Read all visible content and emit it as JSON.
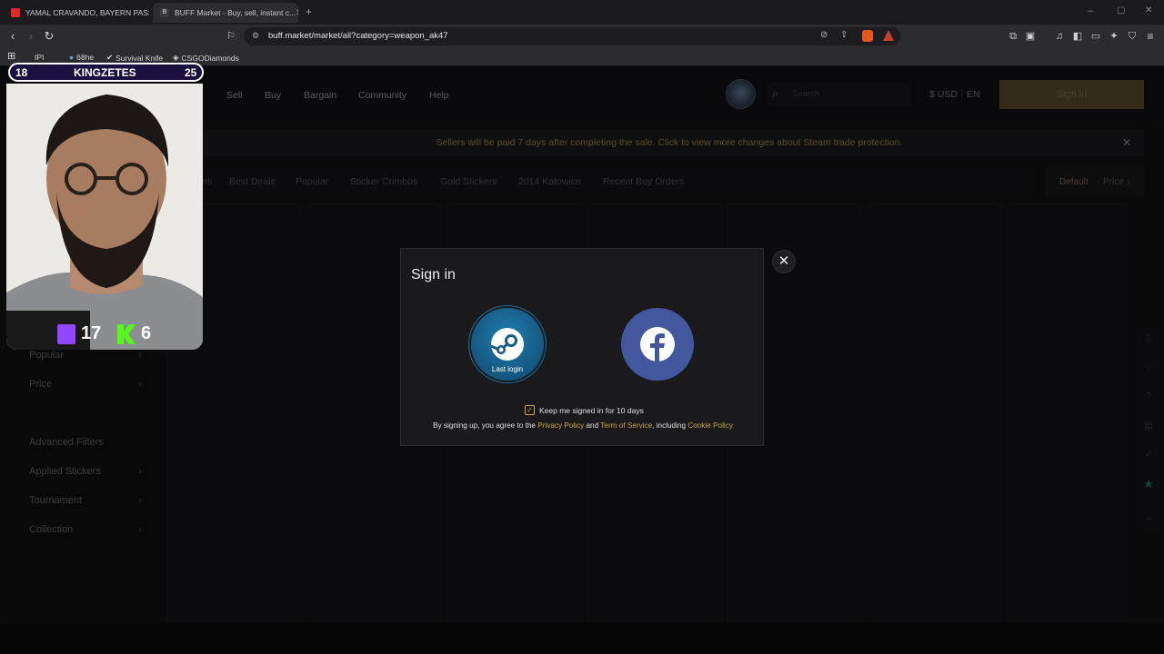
{
  "browser": {
    "tabs": [
      {
        "title": "YAMAL CRAVANDO, BAYERN PASSE...",
        "active": false
      },
      {
        "title": "BUFF Market - Buy, sell, instant c...",
        "active": true
      }
    ],
    "new_tab": "+",
    "url": "buff.market/market/all?category=weapon_ak47",
    "bookmarks": [
      "IPI",
      "68he",
      "Survival Knife",
      "CSGODiamonds"
    ]
  },
  "site": {
    "nav": [
      "Sell",
      "Buy",
      "Bargain",
      "Community",
      "Help"
    ],
    "search_placeholder": "Search",
    "currency": "$ USD",
    "language": "EN",
    "signin_label": "Sign in",
    "notice": "Sellers will be paid 7 days after completing the sale. Click to view more changes about Steam trade protection.",
    "filter_tabs": [
      "ns",
      "Best Deals",
      "Popular",
      "Sticker Combos",
      "Gold Stickers",
      "2014 Katowice",
      "Recent Buy Orders"
    ],
    "sort_default": "Default",
    "sort_price": "Price ↓",
    "sidebar": [
      {
        "label": "Popular",
        "chevron": true
      },
      {
        "label": "Price",
        "chevron": true
      },
      {
        "label": "Advanced Filters",
        "chevron": false
      },
      {
        "label": "Applied Stickers",
        "chevron": true
      },
      {
        "label": "Tournament",
        "chevron": true
      },
      {
        "label": "Collection",
        "chevron": true
      }
    ]
  },
  "modal": {
    "title": "Sign in",
    "steam_caption": "Last login",
    "keep_signed": "Keep me signed in for 10 days",
    "terms_prefix": "By signing up, you agree to the",
    "privacy": "Privacy Policy",
    "and": "and",
    "tos": "Term of Service",
    "including": ", including",
    "cookie": "Cookie Policy"
  },
  "overlay": {
    "left_num": "18",
    "name": "KINGZETES",
    "right_num": "25",
    "twitch_count": "17",
    "kick_count": "6"
  },
  "colors": {
    "accent_gold": "#c9a54a",
    "steam_blue": "#1b6f9e",
    "facebook_blue": "#43579f",
    "overlay_purple": "#1a0f3f"
  }
}
